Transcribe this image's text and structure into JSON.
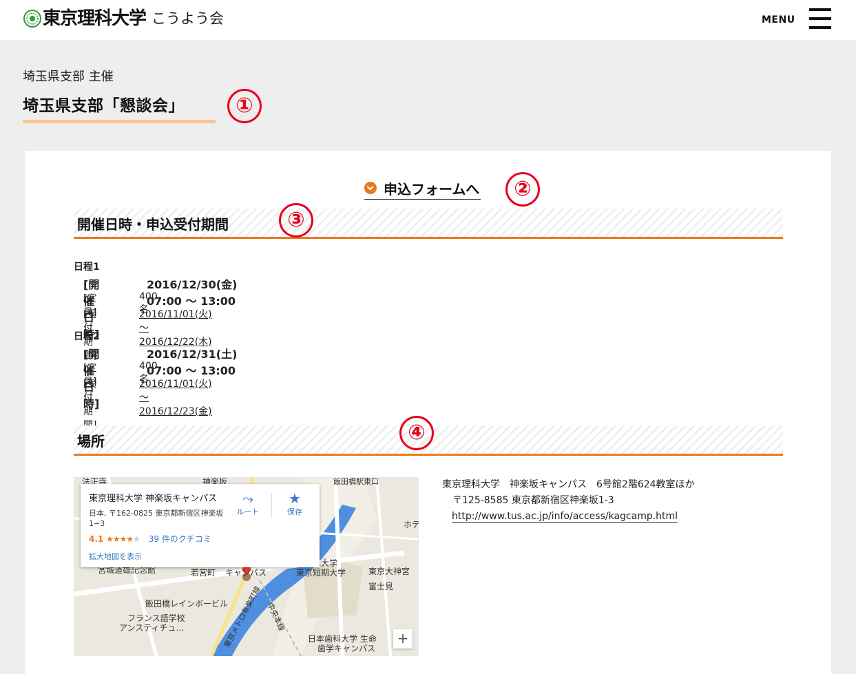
{
  "header": {
    "logo_text": "東京理科大学",
    "logo_sub": "こうよう会",
    "menu_label": "MENU"
  },
  "event": {
    "organizer": "埼玉県支部 主催",
    "title": "埼玉県支部「懇談会」"
  },
  "annotations": [
    "①",
    "②",
    "③",
    "④"
  ],
  "form_link": {
    "label": "申込フォームへ"
  },
  "schedule_section": {
    "heading": "開催日時・申込受付期間"
  },
  "schedules": [
    {
      "day": "日程1",
      "datetime_label": "[開催日時]",
      "datetime": "2016/12/30(金) 07:00 〜 13:00",
      "capacity_label": "[定員]",
      "capacity": "400名",
      "reception_label": "[受付期間]",
      "reception": "2016/11/01(火) 〜 2016/12/22(木)"
    },
    {
      "day": "日程2",
      "datetime_label": "[開催日時]",
      "datetime": "2016/12/31(土) 07:00 〜 13:00",
      "capacity_label": "[定員]",
      "capacity": "400名",
      "reception_label": "[受付期間]",
      "reception": "2016/11/01(火) 〜 2016/12/23(金)"
    }
  ],
  "place_section": {
    "heading": "場所"
  },
  "map": {
    "info_title": "東京理科大学 神楽坂キャンパス",
    "info_address": "日本, 〒162-0825 東京都新宿区神楽坂1−3",
    "rating": "4.1",
    "stars_on": "★★★★",
    "stars_off": "★",
    "reviews": "39 件のクチコミ",
    "enlarge": "拡大地図を表示",
    "route_label": "ルート",
    "save_label": "保存",
    "zoom_in": "+",
    "labels": {
      "l1": "法正寺",
      "l2": "神楽坂",
      "l3": "飯田橋駅東口",
      "l4": "ホテ",
      "l5": "宮城道雄記念館",
      "l6": "若宮町",
      "l7": "キャンパス",
      "l8": "理科大学",
      "l9": "東京短期大学",
      "l10": "東京大神宮",
      "l11": "富士見",
      "l12": "飯田橋レインボービル",
      "l13": "フランス語学校",
      "l14": "アンスティチュ…",
      "l15": "中央本線",
      "l16": "東京メトロ有楽町線",
      "l17": "日本歯科大学 生命",
      "l18": "歯学キャンパス"
    }
  },
  "venue": {
    "line1": "東京理科大学　神楽坂キャンパス　6号館2階624教室ほか",
    "line2": "〒125-8585 東京都新宿区神楽坂1-3",
    "url": "http://www.tus.ac.jp/info/access/kagcamp.html"
  }
}
